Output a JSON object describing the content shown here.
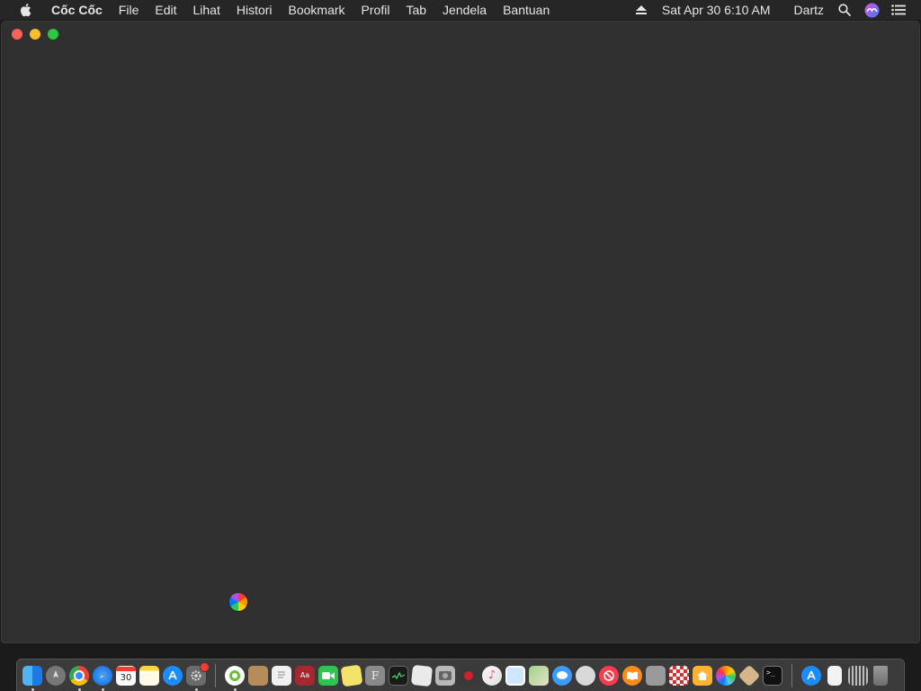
{
  "menubar": {
    "app_name": "Cốc Cốc",
    "menus": [
      "File",
      "Edit",
      "Lihat",
      "Histori",
      "Bookmark",
      "Profil",
      "Tab",
      "Jendela",
      "Bantuan"
    ],
    "datetime": "Sat Apr 30  6:10 AM",
    "user": "Dartz"
  },
  "dock": {
    "calendar_day": "30",
    "dictionary_label": "Aa"
  }
}
